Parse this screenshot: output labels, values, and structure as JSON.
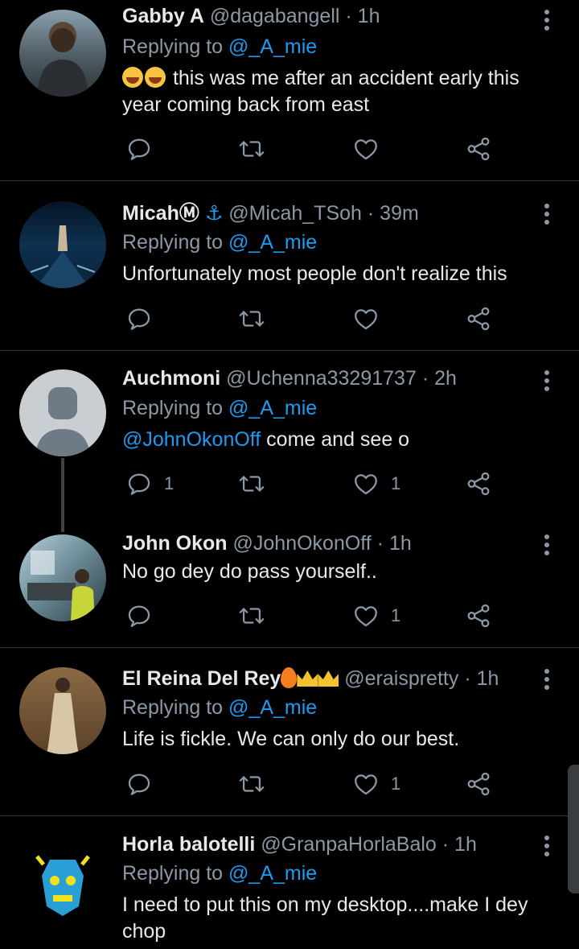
{
  "tweets": [
    {
      "name": "Gabby A",
      "handle": "@dagabangell",
      "time": "· 1h",
      "replying_prefix": "Replying to",
      "replying_handle": "@_A_mie",
      "text": "this was me after an accident early this year coming back from east",
      "emoji": "😂😂",
      "avatar": "person-photo"
    },
    {
      "name": "Micah",
      "name_badge": "Ⓜ",
      "name_symbol": "⚓",
      "handle": "@Micah_TSoh",
      "time": "· 39m",
      "replying_prefix": "Replying to",
      "replying_handle": "@_A_mie",
      "text": "Unfortunately most people don't realize this",
      "avatar": "ship-photo"
    },
    {
      "name": "Auchmoni",
      "handle": "@Uchenna33291737",
      "time": "· 2h",
      "replying_prefix": "Replying to",
      "replying_handle": "@_A_mie",
      "mention": "@JohnOkonOff",
      "text": " come and see o",
      "reply_count": "1",
      "like_count": "1",
      "avatar": "default-avatar"
    },
    {
      "name": "John Okon",
      "handle": "@JohnOkonOff",
      "time": "· 1h",
      "text": "No go dey do pass yourself..",
      "like_count": "1",
      "avatar": "office-photo"
    },
    {
      "name": "El Reina Del Rey",
      "handle": "@eraispretty",
      "time": "· 1h",
      "replying_prefix": "Replying to",
      "replying_handle": "@_A_mie",
      "text": "Life is fickle. We can only do our best.",
      "like_count": "1",
      "avatar": "gown-photo"
    },
    {
      "name": "Horla balotelli",
      "handle": "@GranpaHorlaBalo",
      "time": "· 1h",
      "replying_prefix": "Replying to",
      "replying_handle": "@_A_mie",
      "text": "I need to put this on my desktop....make I dey chop",
      "avatar": "mask-art"
    }
  ],
  "colors": {
    "background": "#000000",
    "text": "#e7e9ea",
    "muted": "#8b98a5",
    "link": "#1d9bf0",
    "divider": "#2f3336"
  }
}
